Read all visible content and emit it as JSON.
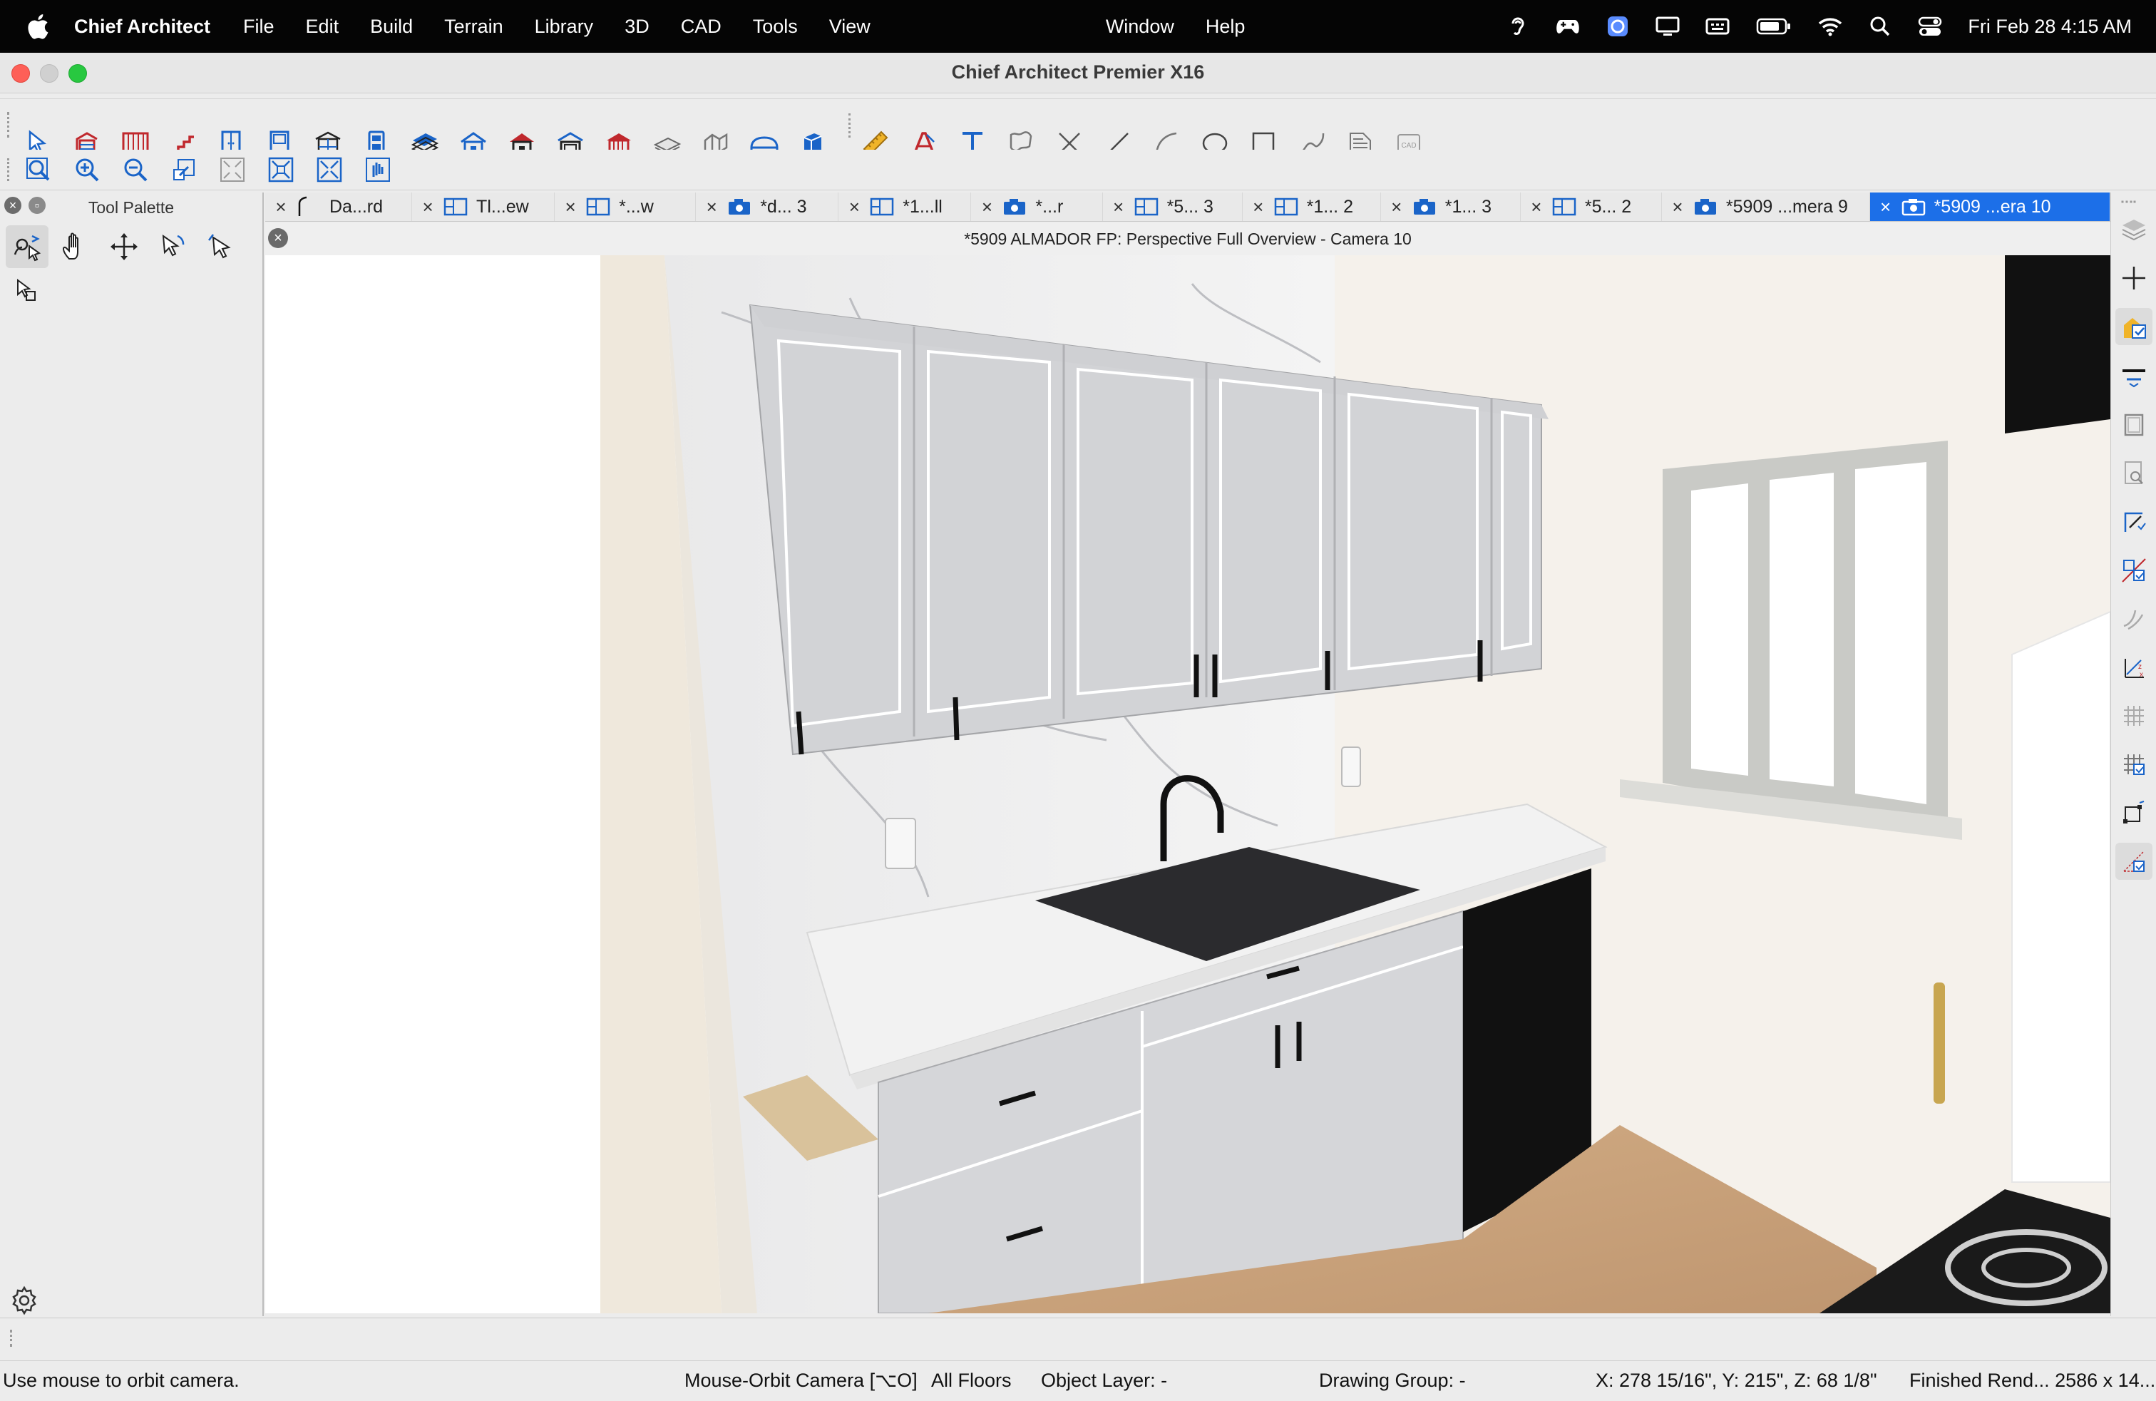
{
  "menubar": {
    "app_name": "Chief Architect",
    "items": [
      "File",
      "Edit",
      "Build",
      "Terrain",
      "Library",
      "3D",
      "CAD",
      "Tools",
      "View"
    ],
    "right_items": [
      "Window",
      "Help"
    ],
    "status_icons": [
      "hearing-icon",
      "game-controller-icon",
      "browser-icon",
      "display-icon",
      "keyboard-icon",
      "battery-icon",
      "wifi-icon",
      "search-icon",
      "control-center-icon"
    ],
    "clock": "Fri Feb 28  4:15 AM"
  },
  "window": {
    "title": "Chief Architect Premier X16"
  },
  "toolbar_1": {
    "icons": [
      "select-objects-icon",
      "wall-tools-icon",
      "railing-icon",
      "stairs-icon",
      "cabinet-tools-icon",
      "door-tools-icon",
      "window-tools-icon",
      "closet-icon",
      "roof-tools-icon",
      "house-icon",
      "room-icon",
      "garage-icon",
      "deck-icon",
      "slab-icon",
      "furniture-icon",
      "arch-icon",
      "3d-object-icon",
      "dimension-icon",
      "text-tools-icon",
      "text-icon",
      "callout-icon",
      "cross-icon",
      "line-icon",
      "arc-icon",
      "circle-icon",
      "rectangle-icon",
      "spline-icon",
      "library-icon",
      "cad-block-icon"
    ]
  },
  "toolbar_2": {
    "icons": [
      "zoom-icon",
      "zoom-in-icon",
      "zoom-out-icon",
      "undo-zoom-icon",
      "fill-window-icon",
      "fill-window-all-icon",
      "full-screen-icon",
      "pan-icon"
    ]
  },
  "tool_palette": {
    "title": "Tool Palette",
    "tools": [
      "orbit-camera-icon",
      "pan-hand-icon",
      "move-icon",
      "rotate-select-icon",
      "select-arrow-icon",
      "select-edit-icon"
    ]
  },
  "tabs": [
    {
      "label": "Da...rd",
      "icon": "elevation-icon",
      "active": false
    },
    {
      "label": "Tl...ew",
      "icon": "plan-view-icon",
      "active": false
    },
    {
      "label": "*...w",
      "icon": "plan-view-icon",
      "active": false
    },
    {
      "label": "*d... 3",
      "icon": "camera-icon",
      "active": false
    },
    {
      "label": "*1...ll",
      "icon": "plan-view-icon",
      "active": false
    },
    {
      "label": "*...r",
      "icon": "camera-icon",
      "active": false
    },
    {
      "label": "*5... 3",
      "icon": "plan-view-icon",
      "active": false
    },
    {
      "label": "*1... 2",
      "icon": "plan-view-icon",
      "active": false
    },
    {
      "label": "*1... 3",
      "icon": "camera-icon",
      "active": false
    },
    {
      "label": "*5... 2",
      "icon": "plan-view-icon",
      "active": false
    },
    {
      "label": "*5909 ...mera 9",
      "icon": "camera-icon",
      "active": false
    },
    {
      "label": "*5909 ...era 10",
      "icon": "camera-icon",
      "active": true
    }
  ],
  "view": {
    "title": "*5909 ALMADOR FP: Perspective Full Overview - Camera 10"
  },
  "side_toolbar": {
    "icons": [
      "layers-icon",
      "add-icon",
      "materials-icon",
      "edit-toolbar-icon",
      "window-panel-icon",
      "inspect-icon",
      "dimension-edit-icon",
      "cross-section-icon",
      "terrain-icon",
      "axis-icon",
      "grid-icon",
      "snap-grid-icon",
      "object-snap-icon",
      "angle-snap-icon"
    ]
  },
  "status": {
    "message": "Use mouse to orbit camera.",
    "mode": "Mouse-Orbit Camera [⌥O]",
    "floors": "All Floors",
    "object_layer": "Object Layer: -",
    "drawing_group": "Drawing Group: -",
    "coordinates": "X: 278 15/16\", Y: 215\", Z: 68 1/8\"",
    "render_info": "Finished Rend... 2586 x 14..."
  },
  "colors": {
    "accent": "#1c6fe8",
    "menubar_bg": "#050505",
    "cabinet": "#d2d3d6",
    "countertop": "#f2f2f2",
    "floor": "#c9a37c",
    "dishwasher": "#111111"
  }
}
